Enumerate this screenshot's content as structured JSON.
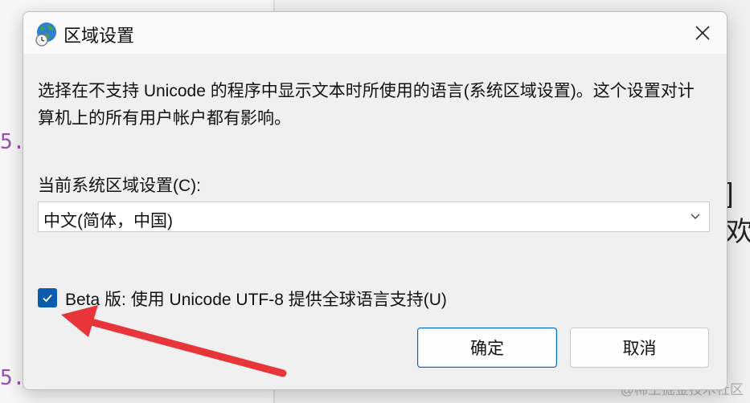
{
  "background": {
    "code_fragments": [
      "5.",
      "5."
    ],
    "right_text": "]欢",
    "watermark": "@稀土掘金技术社区"
  },
  "dialog": {
    "title": "区域设置",
    "icon": "globe-clock-icon",
    "close_icon": "close-icon",
    "description": "选择在不支持 Unicode 的程序中显示文本时所使用的语言(系统区域设置)。这个设置对计算机上的所有用户帐户都有影响。",
    "locale_label": "当前系统区域设置(C):",
    "locale_value": "中文(简体，中国)",
    "beta_checkbox": {
      "checked": true,
      "label": "Beta 版: 使用 Unicode UTF-8 提供全球语言支持(U)"
    },
    "ok_label": "确定",
    "cancel_label": "取消"
  },
  "colors": {
    "accent": "#0b5cad",
    "annotation_arrow": "#e8353a"
  }
}
